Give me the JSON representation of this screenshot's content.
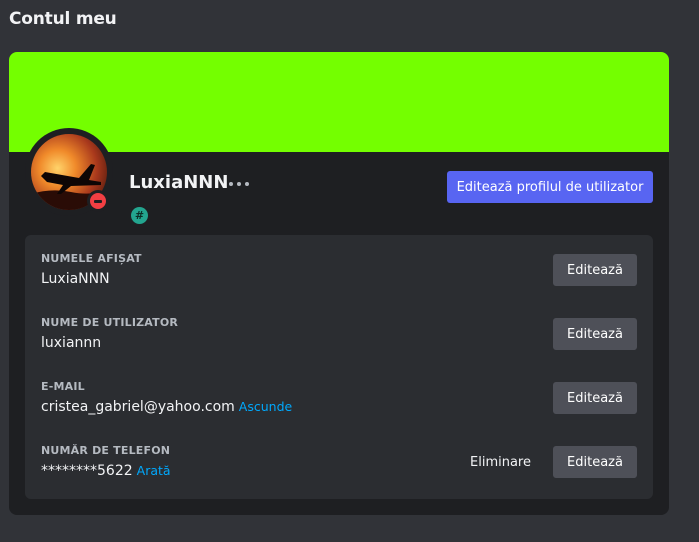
{
  "page": {
    "title": "Contul meu"
  },
  "profile": {
    "banner_color": "#74ff00",
    "username": "LuxiaNNN",
    "status": "do-not-disturb",
    "status_color": "#f23f43",
    "badge_icon": "hash-icon",
    "badge_symbol": "#",
    "more_icon": "ellipsis-icon",
    "edit_profile_label": "Editează profilul de utilizator",
    "accent_color": "#5865f2"
  },
  "fields": [
    {
      "label": "NUMELE AFIȘAT",
      "value": "LuxiaNNN",
      "edit_label": "Editează"
    },
    {
      "label": "NUME DE UTILIZATOR",
      "value": "luxiannn",
      "edit_label": "Editează"
    },
    {
      "label": "E-MAIL",
      "value": "cristea_gabriel@yahoo.com",
      "link_label": "Ascunde",
      "edit_label": "Editează"
    },
    {
      "label": "NUMĂR DE TELEFON",
      "value": "********5622",
      "link_label": "Arată",
      "remove_label": "Eliminare",
      "edit_label": "Editează"
    }
  ]
}
